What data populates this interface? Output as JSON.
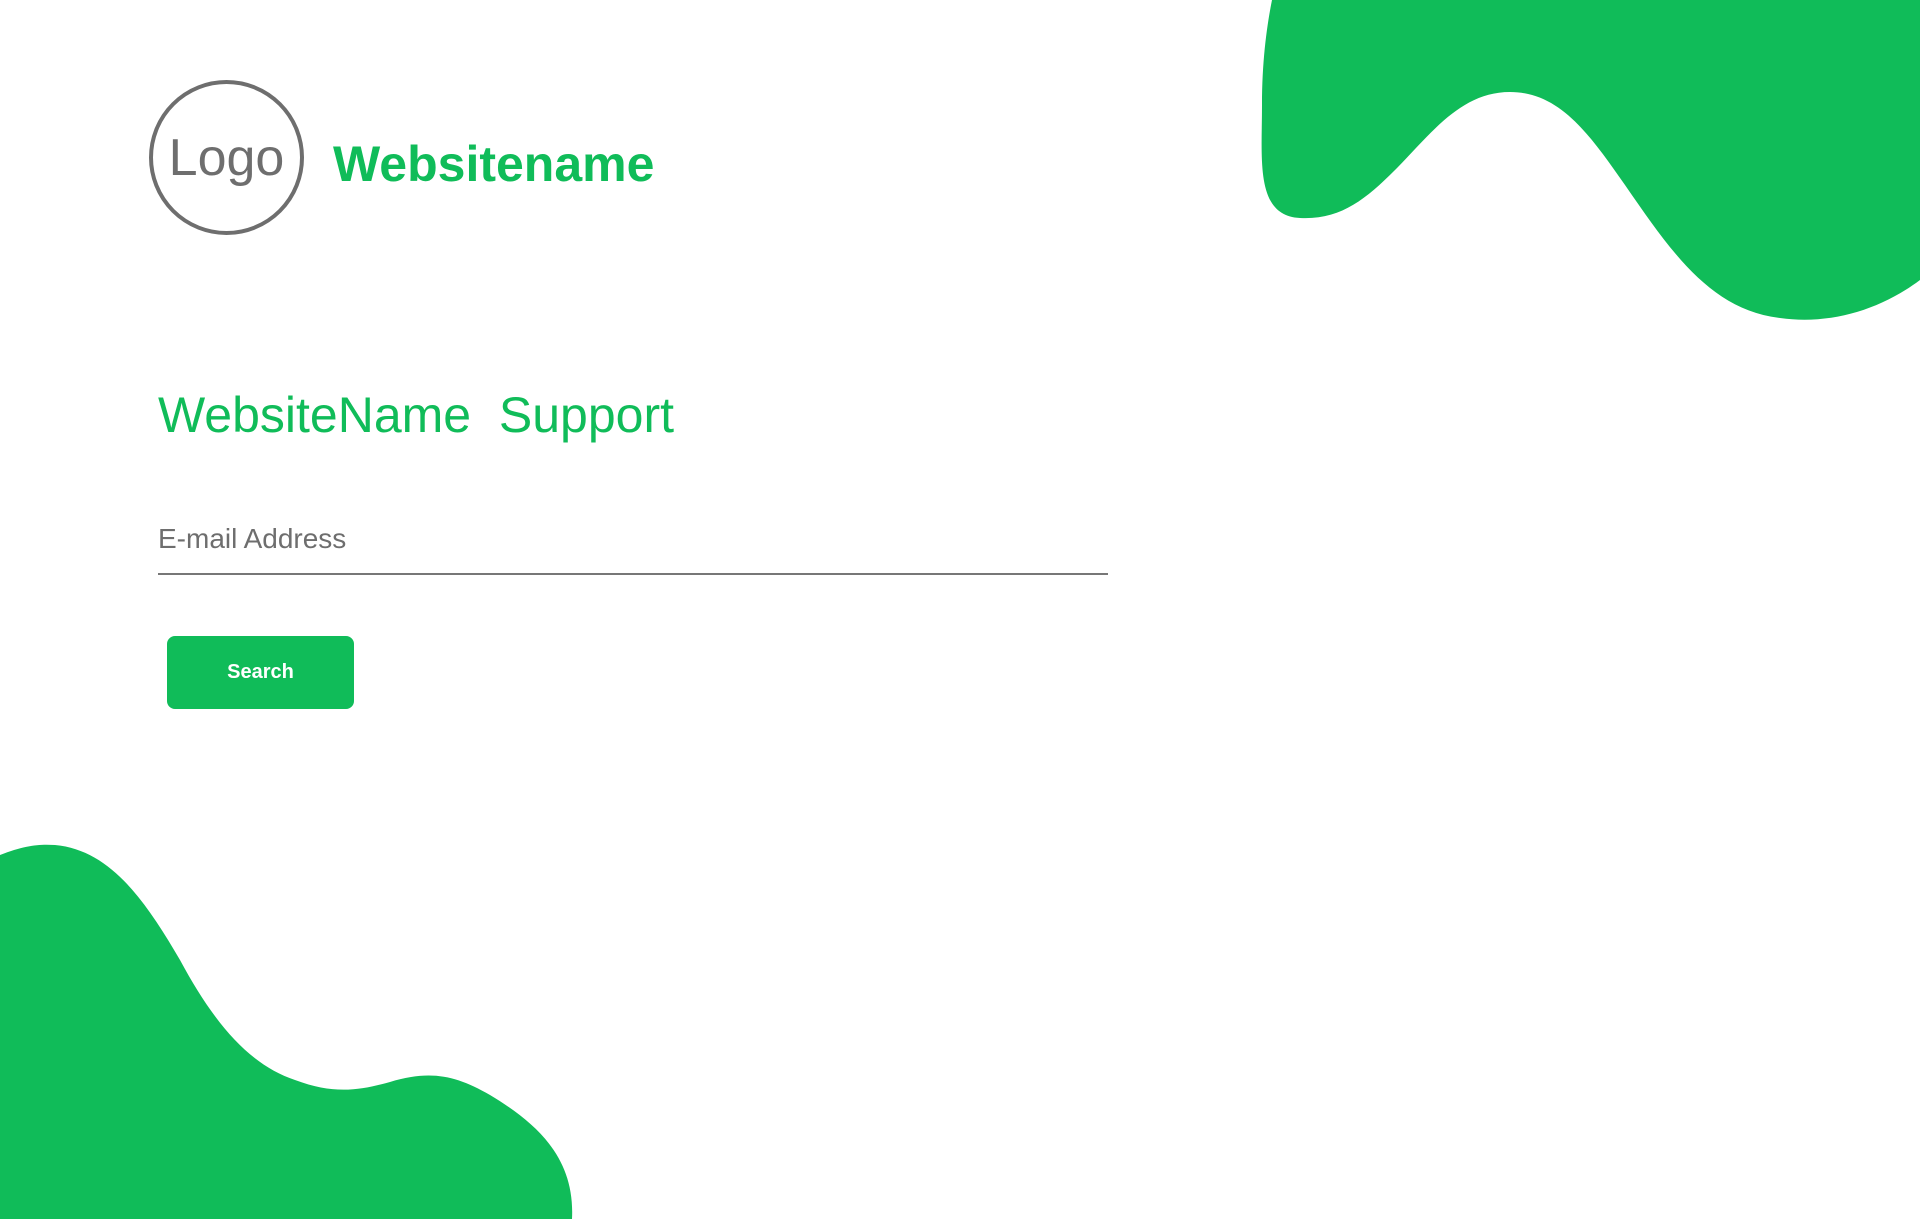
{
  "logo": {
    "text": "Logo"
  },
  "header": {
    "site_name": "Websitename"
  },
  "main": {
    "title": "WebsiteName  Support",
    "email_input": {
      "placeholder": "E-mail Address",
      "value": ""
    },
    "search_button_label": "Search"
  },
  "colors": {
    "brand_green": "#10bc59",
    "logo_gray": "#6e6e6e",
    "underline_gray": "#777777",
    "background": "#ffffff"
  }
}
